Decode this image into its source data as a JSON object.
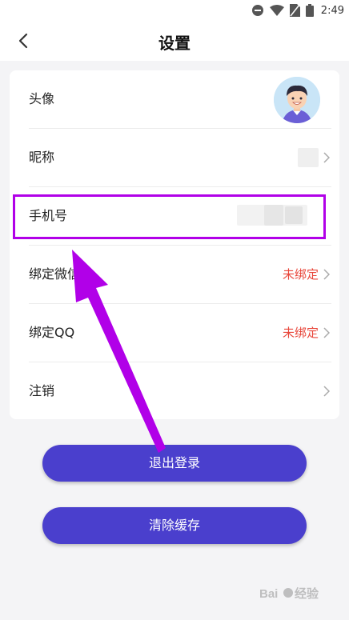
{
  "status_bar": {
    "time": "2:49"
  },
  "header": {
    "title": "设置"
  },
  "rows": [
    {
      "label": "头像"
    },
    {
      "label": "昵称"
    },
    {
      "label": "手机号"
    },
    {
      "label": "绑定微信",
      "value": "未绑定"
    },
    {
      "label": "绑定QQ",
      "value": "未绑定"
    },
    {
      "label": "注销"
    }
  ],
  "buttons": {
    "logout": "退出登录",
    "clear_cache": "清除缓存"
  },
  "watermark": "Baidu 经验",
  "colors": {
    "accent": "#4a3fcd",
    "unbound": "#e8463a",
    "annotation": "#b100e8"
  }
}
